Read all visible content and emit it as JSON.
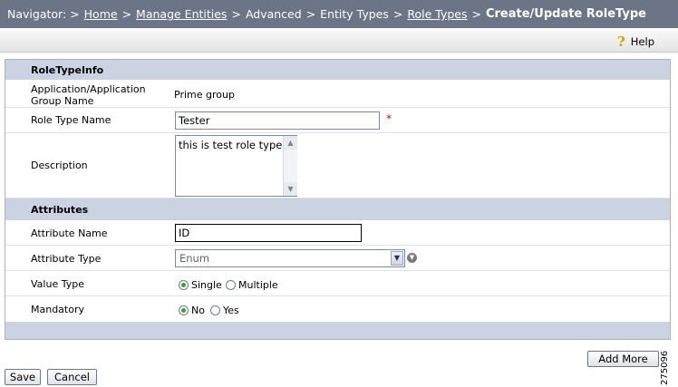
{
  "breadcrumb": {
    "prefix": "Navigator:",
    "items": [
      "Home",
      "Manage Entities",
      "Advanced",
      "Entity Types",
      "Role Types"
    ],
    "current": "Create/Update RoleType",
    "separator": ">"
  },
  "toolbar": {
    "help_label": "Help",
    "help_icon": "question-mark-icon"
  },
  "role_type_info": {
    "header": "RoleTypeInfo",
    "app_label": "Application/Application Group Name",
    "app_value": "Prime group",
    "name_label": "Role Type Name",
    "name_value": "Tester",
    "required_marker": "*",
    "description_label": "Description",
    "description_value": "this is test role type"
  },
  "attributes": {
    "header": "Attributes",
    "name_label": "Attribute Name",
    "name_value": "ID",
    "type_label": "Attribute Type",
    "type_value": "Enum",
    "value_type_label": "Value Type",
    "value_type_options": [
      "Single",
      "Multiple"
    ],
    "value_type_selected": "Single",
    "mandatory_label": "Mandatory",
    "mandatory_options": [
      "No",
      "Yes"
    ],
    "mandatory_selected": "No"
  },
  "buttons": {
    "add_more": "Add More",
    "save": "Save",
    "cancel": "Cancel"
  },
  "figure_id": "275096",
  "colors": {
    "nav_bg": "#6b7586",
    "section_bg": "#cbd3e2",
    "radio_on": "#3a9d3a",
    "required": "#cc0000"
  }
}
